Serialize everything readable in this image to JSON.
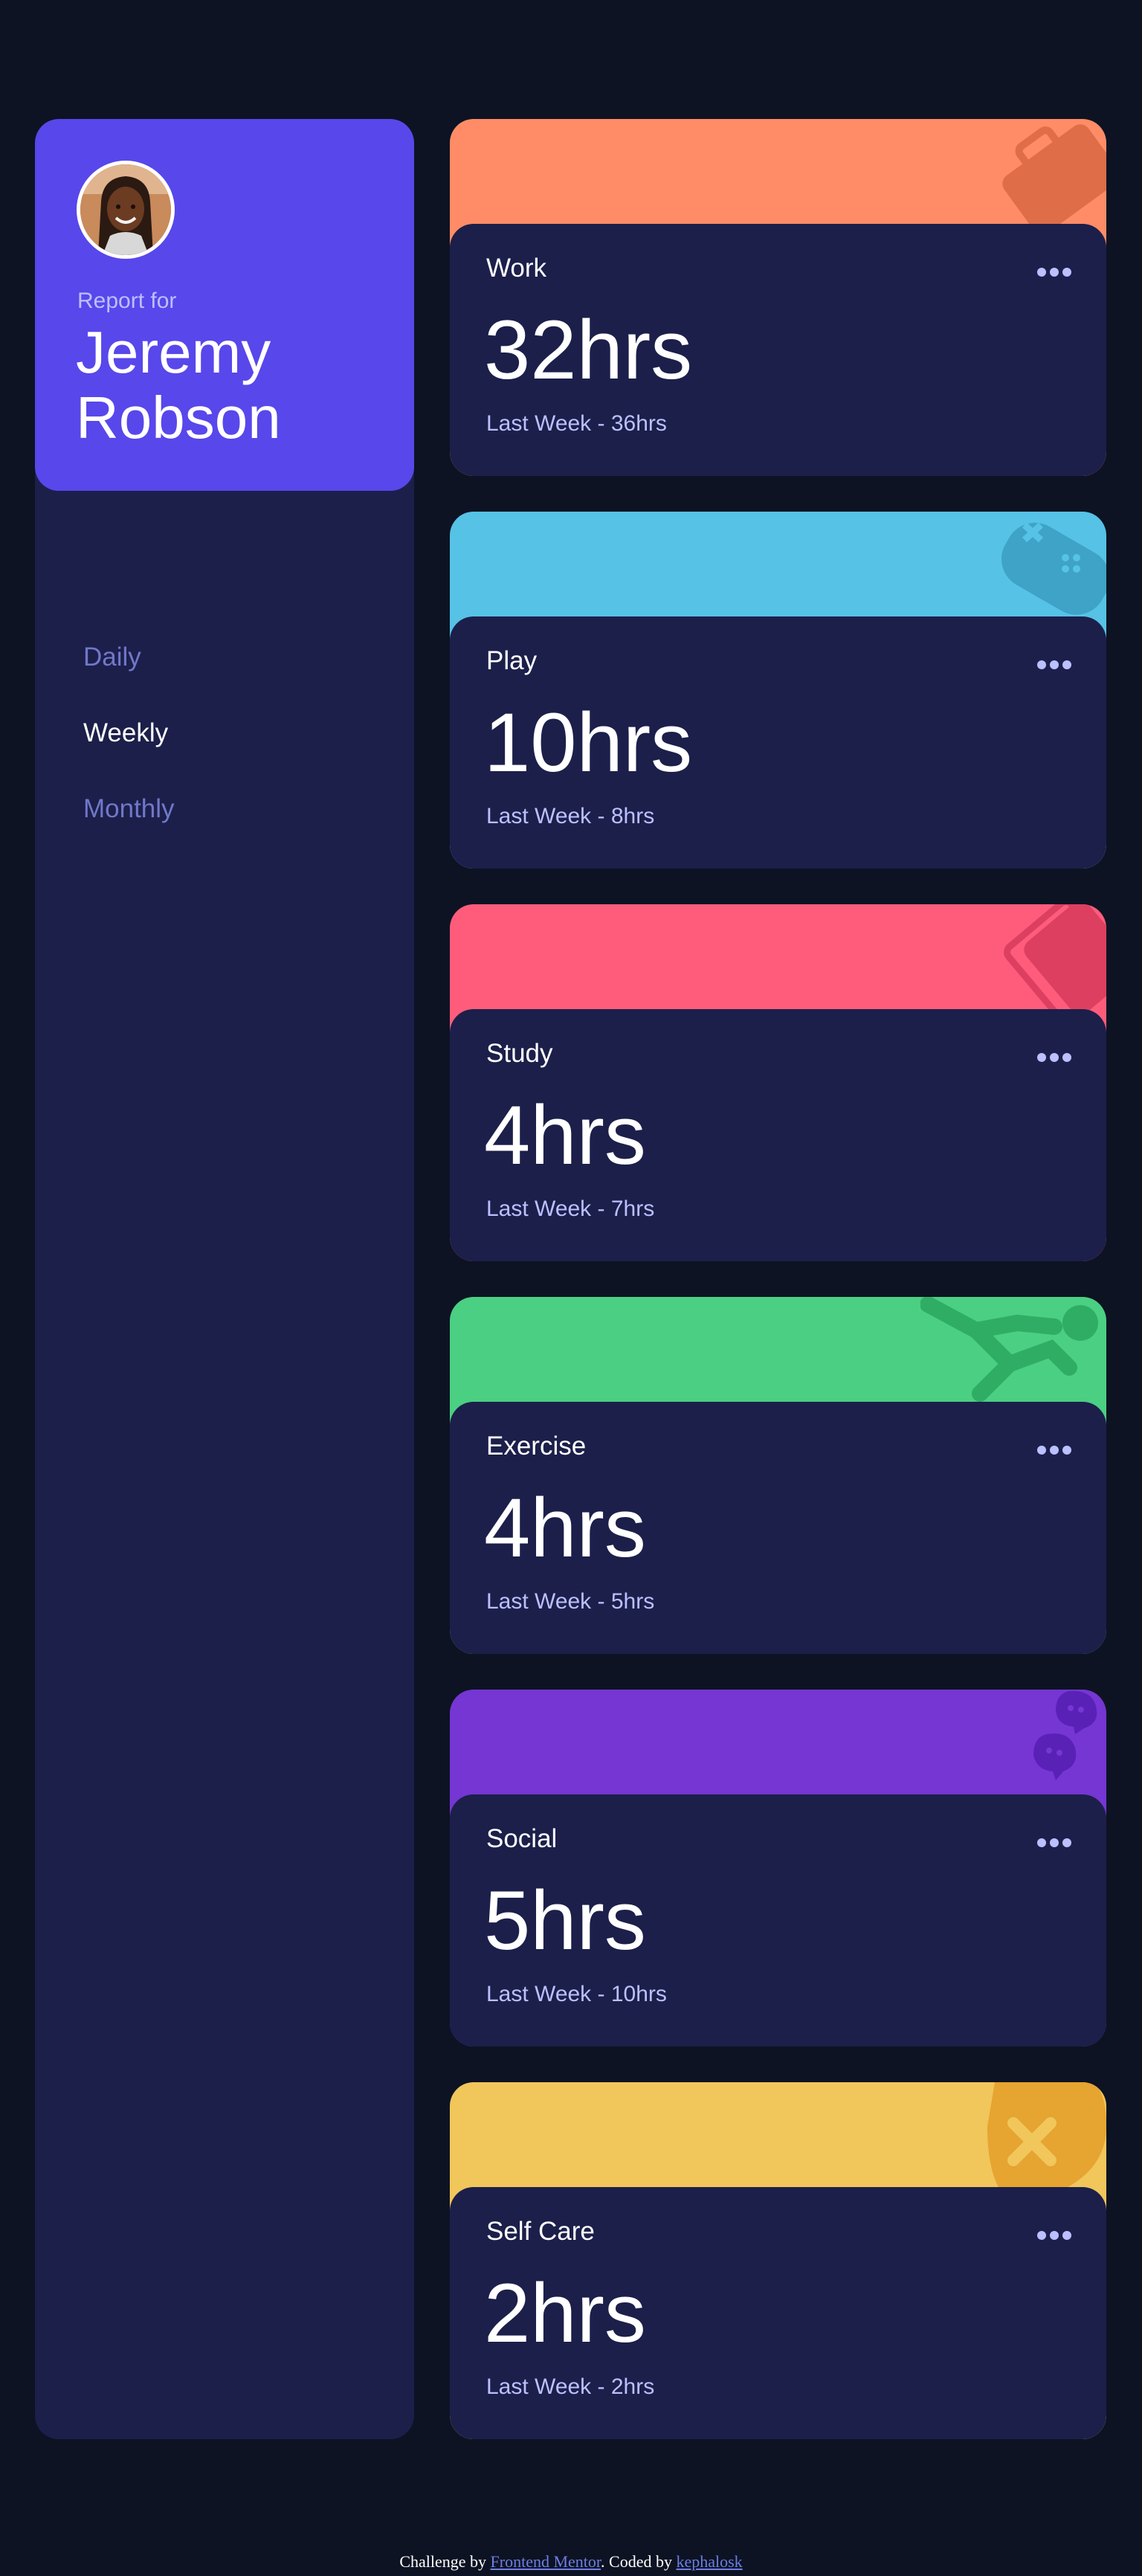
{
  "profile": {
    "report_for": "Report for",
    "name": "Jeremy Robson",
    "avatar": "avatar-photo"
  },
  "periods": [
    {
      "label": "Daily",
      "active": false
    },
    {
      "label": "Weekly",
      "active": true
    },
    {
      "label": "Monthly",
      "active": false
    }
  ],
  "cards": [
    {
      "title": "Work",
      "hours": "32hrs",
      "previous": "Last Week - 36hrs",
      "color": "#ff8c66",
      "icon": "briefcase-icon"
    },
    {
      "title": "Play",
      "hours": "10hrs",
      "previous": "Last Week - 8hrs",
      "color": "#56c2e6",
      "icon": "gamepad-icon"
    },
    {
      "title": "Study",
      "hours": "4hrs",
      "previous": "Last Week - 7hrs",
      "color": "#ff5c7c",
      "icon": "book-icon"
    },
    {
      "title": "Exercise",
      "hours": "4hrs",
      "previous": "Last Week - 5hrs",
      "color": "#4bcf82",
      "icon": "running-icon"
    },
    {
      "title": "Social",
      "hours": "5hrs",
      "previous": "Last Week - 10hrs",
      "color": "#7536d3",
      "icon": "chat-icon"
    },
    {
      "title": "Self Care",
      "hours": "2hrs",
      "previous": "Last Week - 2hrs",
      "color": "#f1c65b",
      "icon": "heart-icon"
    }
  ],
  "footer": {
    "prefix": "Challenge by ",
    "link1": "Frontend Mentor",
    "middle": ". Coded by ",
    "link2": "kephalosk"
  },
  "colors": {
    "page_bg": "#0d1323",
    "panel_bg": "#1c1f4a",
    "accent": "#5847eb",
    "muted_text": "#bbc0ff",
    "inactive_tab": "#7078c9"
  }
}
